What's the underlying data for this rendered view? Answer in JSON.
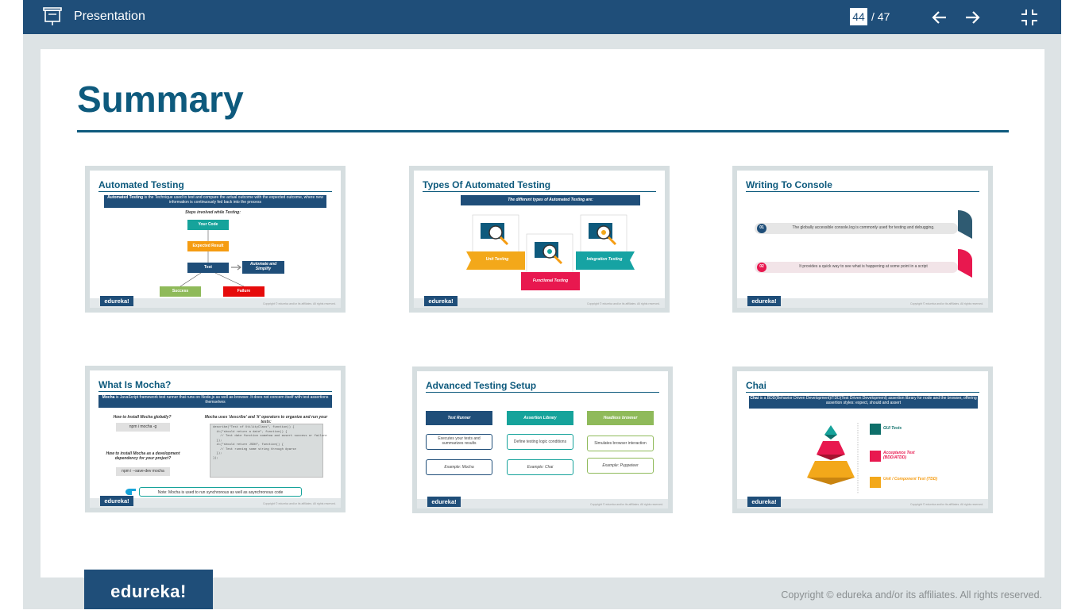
{
  "toolbar": {
    "title": "Presentation",
    "current_page": "44",
    "total_pages": "/ 47"
  },
  "slide": {
    "title": "Summary",
    "footer_logo": "edureka!",
    "copyright": "Copyright © edureka and/or its affiliates. All rights reserved."
  },
  "thumbs": [
    {
      "title": "Automated Testing",
      "intro_bold": "Automated Testing",
      "intro": "is the Technique used to test and compare the actual outcome with the expected outcome, where new information is continuously fed back into the process",
      "steps_title": "Steps involved while Testing:",
      "your_code": "Your Code",
      "expected": "Expected Result",
      "test": "Test",
      "automate": "Automate and Simplify",
      "success": "Success",
      "failure": "Failure"
    },
    {
      "title": "Types Of Automated Testing",
      "banner": "The different types of Automated Testing are:",
      "unit": "Unit Testing",
      "functional": "Functional Testing",
      "integration": "Integration Testing"
    },
    {
      "title": "Writing To Console",
      "n1": "01",
      "t1": "The globally accessible console.log is commonly used for testing and debugging.",
      "n2": "02",
      "t2": "It provides a quick way to see what is happening at some point in a script"
    },
    {
      "title": "What Is Mocha?",
      "intro_bold": "Mocha",
      "intro": "is JavaScript framework test runner that runs on Node.js as well as browser. It does not concern itself with test assertions themselves",
      "q1": "How to Install Mocha globally?",
      "c1": "npm i mocha -g",
      "q2": "How to install Mocha as a development dependency for your project?",
      "c2": "npm i --save-dev mocha",
      "right_title": "Mocha uses 'describe' and 'it' operators to organize and run your tests:",
      "code": [
        "describe(\"Test of UtilityClass\", function() {",
        "  it(\"should return a date\", function() {",
        "    // Test date function somehow and assert success or failure",
        "  });",
        "  it(\"should return JSON\", function() {",
        "    // Test running some string through #parse",
        "  });",
        "});"
      ],
      "note": "Note: Mocha is used to run synchronous as well as asynchronous code"
    },
    {
      "title": "Advanced Testing Setup",
      "h1": "Test Runner",
      "h2": "Assertion Library",
      "h3": "Headless browser",
      "d1": "Executes your tests and summarizes results",
      "d2": "Define testing logic conditions",
      "d3": "Simulates browser interaction",
      "e1": "Example: Mocha",
      "e2": "Example: Chai",
      "e3": "Example: Puppeteer"
    },
    {
      "title": "Chai",
      "intro_bold": "Chai",
      "intro": "is a BDD(Behavior Driven Development)/TDD(Test Driven Development) assertion library for node and the browser, offering assertion styles: expect, should and assert",
      "l1": "GUI Tests",
      "l2": "Acceptance Test (BDD/ATDD)",
      "l3": "Unit / Component Test (TDD)"
    }
  ],
  "colors": {
    "toolbar": "#1f4e79",
    "title": "#0e5a7d",
    "teal": "#16a39b",
    "orange": "#f59c12",
    "green": "#8fba5a",
    "red": "#e60b0b",
    "pink": "#e8184f",
    "gold": "#f3a81a"
  }
}
